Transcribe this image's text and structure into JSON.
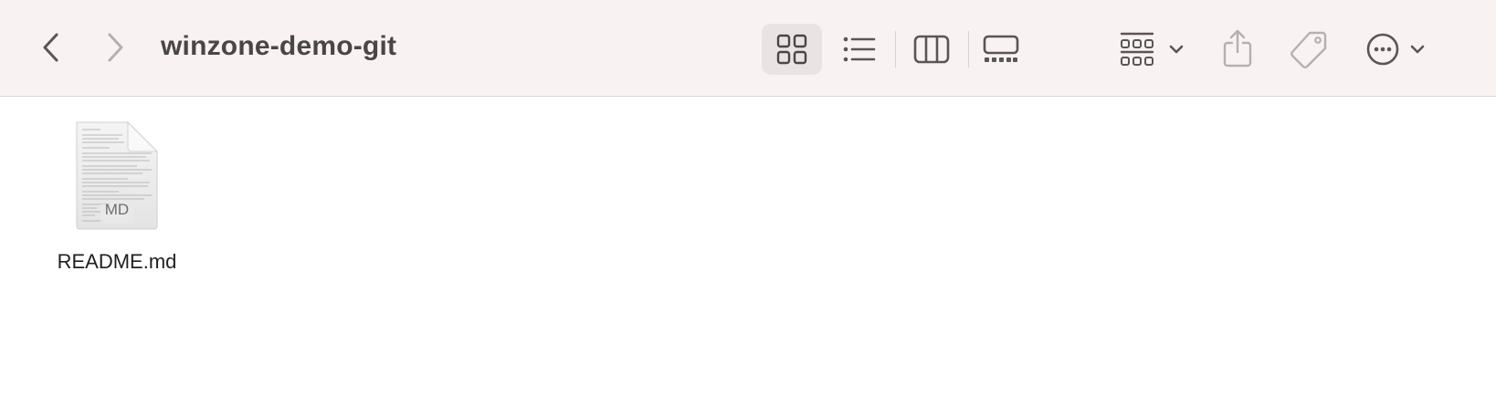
{
  "window": {
    "title": "winzone-demo-git"
  },
  "toolbar": {
    "back_icon": "chevron-left-icon",
    "forward_icon": "chevron-right-icon",
    "view_modes": [
      {
        "name": "icon-view",
        "icon": "grid-icon",
        "selected": true
      },
      {
        "name": "list-view",
        "icon": "list-icon",
        "selected": false
      },
      {
        "name": "column-view",
        "icon": "columns-icon",
        "selected": false
      },
      {
        "name": "gallery-view",
        "icon": "gallery-icon",
        "selected": false
      }
    ],
    "group_icon": "group-by-icon",
    "share_icon": "share-icon",
    "tag_icon": "tag-icon",
    "more_icon": "ellipsis-circle-icon",
    "colors": {
      "toolbar_bg": "#f8f2f2",
      "icon_color": "#5a5556",
      "disabled_icon_color": "#b5b0b1",
      "selected_bg": "#e9e3e3"
    }
  },
  "files": [
    {
      "name": "README.md",
      "type_label": "MD",
      "icon": "markdown-document-icon"
    }
  ]
}
